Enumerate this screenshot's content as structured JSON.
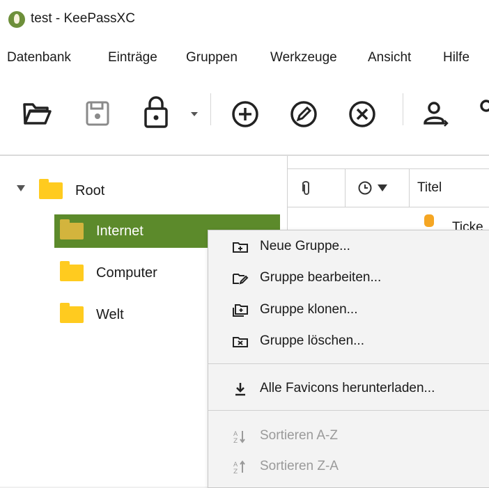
{
  "window": {
    "title": "test - KeePassXC"
  },
  "menubar": {
    "items": [
      "Datenbank",
      "Einträge",
      "Gruppen",
      "Werkzeuge",
      "Ansicht",
      "Hilfe"
    ]
  },
  "toolbar": {
    "icons": [
      "open-folder-icon",
      "save-icon",
      "lock-icon",
      "dropdown-arrow-icon",
      "add-entry-icon",
      "edit-entry-icon",
      "delete-entry-icon",
      "user-transfer-icon"
    ]
  },
  "tree": {
    "root": "Root",
    "groups": [
      "Internet",
      "Computer",
      "Welt"
    ]
  },
  "entries": {
    "columns": {
      "title": "Titel"
    },
    "first_row_title": "Ticke"
  },
  "context_menu": {
    "new_group": "Neue Gruppe...",
    "edit_group": "Gruppe bearbeiten...",
    "clone_group": "Gruppe klonen...",
    "delete_group": "Gruppe löschen...",
    "download_favicons": "Alle Favicons herunterladen...",
    "sort_az": "Sortieren A-Z",
    "sort_za": "Sortieren Z-A"
  },
  "colors": {
    "selection": "#5c8a2b",
    "folder": "#ffcb1f"
  }
}
